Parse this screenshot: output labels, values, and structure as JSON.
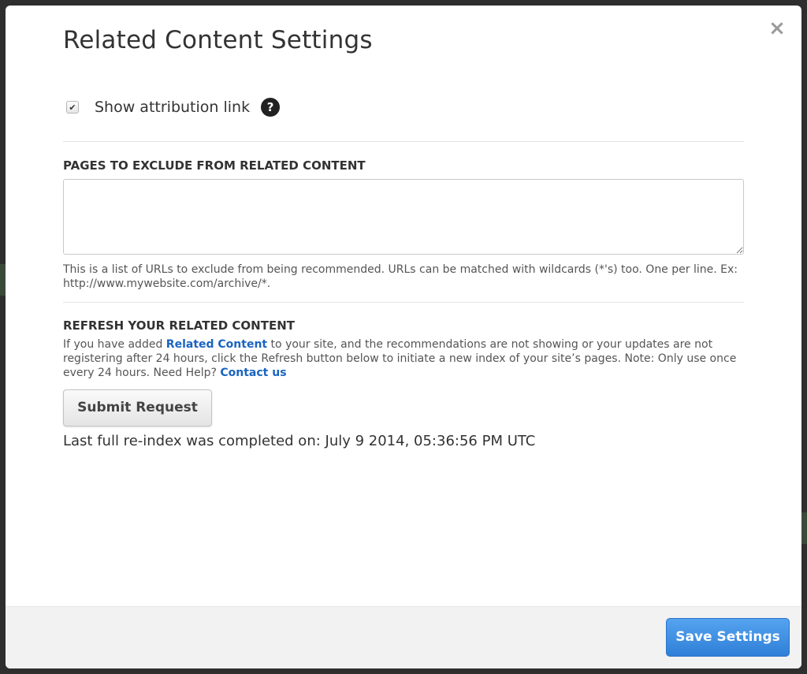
{
  "modal": {
    "title": "Related Content Settings",
    "close_symbol": "×"
  },
  "attribution": {
    "checked": true,
    "check_symbol": "✔",
    "label": "Show attribution link",
    "help_symbol": "?"
  },
  "exclude": {
    "heading": "PAGES TO EXCLUDE FROM RELATED CONTENT",
    "value": "",
    "help": "This is a list of URLs to exclude from being recommended. URLs can be matched with wildcards (*'s) too. One per line. Ex: http://www.mywebsite.com/archive/*."
  },
  "refresh": {
    "heading": "REFRESH YOUR RELATED CONTENT",
    "text_before_link": "If you have added ",
    "related_content_link": "Related Content",
    "text_after_link": " to your site, and the recommendations are not showing or your updates are not registering after 24 hours, click the Refresh button below to initiate a new index of your site’s pages. Note: Only use once every 24 hours. Need Help? ",
    "contact_link": "Contact us",
    "submit_label": "Submit Request",
    "last_index": "Last full re-index was completed on: July 9 2014, 05:36:56 PM UTC"
  },
  "footer": {
    "save_label": "Save Settings"
  },
  "colors": {
    "link": "#1a64c0",
    "primary_button": "#3a8ce2",
    "footer_bg": "#f2f2f2"
  }
}
